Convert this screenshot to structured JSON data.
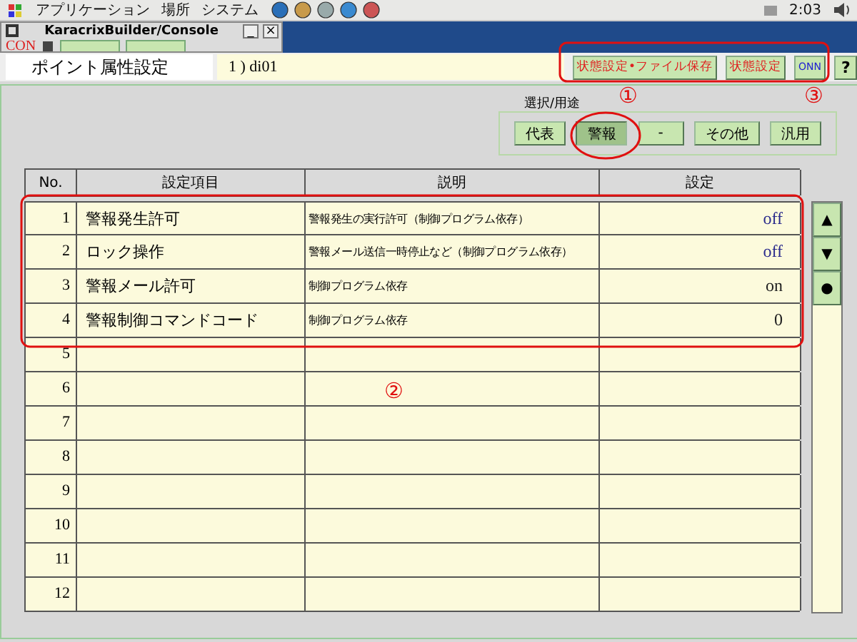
{
  "desktop_panel": {
    "menus": [
      "アプリケーション",
      "場所",
      "システム"
    ],
    "clock": "2:03"
  },
  "mini_window": {
    "title": "KaracrixBuilder/Console",
    "toolbar_label": "CON",
    "window_buttons": [
      "_",
      "×"
    ]
  },
  "header": {
    "title": "ポイント属性設定",
    "point": "1 ) di01",
    "buttons": [
      {
        "label": "状態設定•ファイル保存",
        "kind": "action"
      },
      {
        "label": "状態設定",
        "kind": "action"
      },
      {
        "label": "ONN",
        "kind": "toggle"
      },
      {
        "label": "?",
        "kind": "help"
      }
    ]
  },
  "selector": {
    "label": "選択/用途",
    "options": [
      {
        "label": "代表",
        "selected": false
      },
      {
        "label": "警報",
        "selected": true
      },
      {
        "label": "-",
        "selected": false
      },
      {
        "label": "その他",
        "selected": false
      },
      {
        "label": "汎用",
        "selected": false
      }
    ]
  },
  "table": {
    "columns": [
      "No.",
      "設定項目",
      "説明",
      "設定"
    ],
    "rows": [
      {
        "no": "1",
        "item": "警報発生許可",
        "description": "警報発生の実行許可（制御プログラム依存）",
        "value": "off",
        "color": "#2b2b8c"
      },
      {
        "no": "2",
        "item": "ロック操作",
        "description": "警報メール送信一時停止など（制御プログラム依存）",
        "value": "off",
        "color": "#2b2b8c"
      },
      {
        "no": "3",
        "item": "警報メール許可",
        "description": "制御プログラム依存",
        "value": "on",
        "color": "#222222"
      },
      {
        "no": "4",
        "item": "警報制御コマンドコード",
        "description": "制御プログラム依存",
        "value": "0",
        "color": "#222222"
      },
      {
        "no": "5"
      },
      {
        "no": "6"
      },
      {
        "no": "7"
      },
      {
        "no": "8"
      },
      {
        "no": "9"
      },
      {
        "no": "10"
      },
      {
        "no": "11"
      },
      {
        "no": "12"
      }
    ]
  },
  "scroll_buttons": [
    "▲",
    "▼",
    "●"
  ],
  "annotations": [
    "①",
    "②",
    "③"
  ]
}
